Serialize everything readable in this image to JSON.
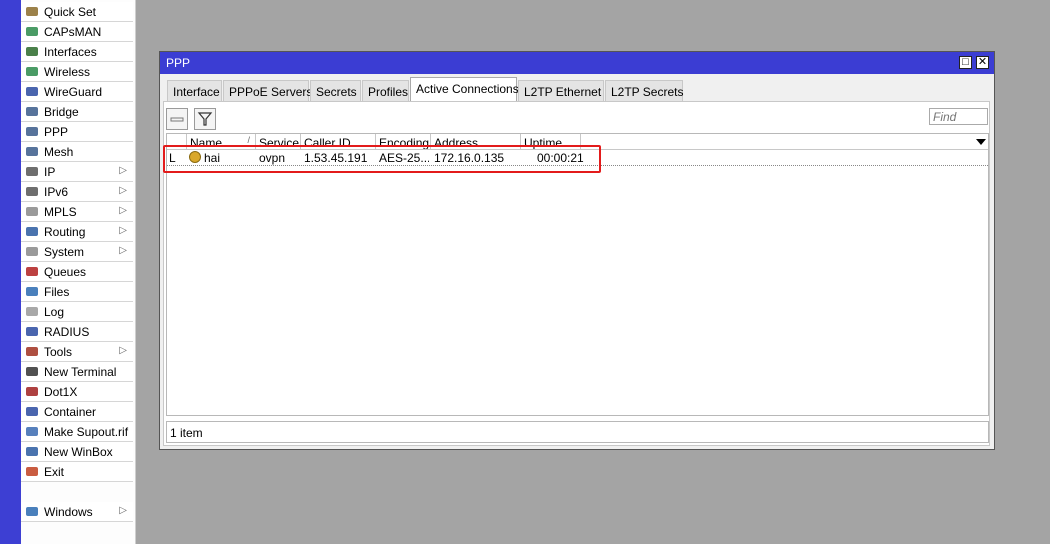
{
  "sidebar": {
    "items": [
      {
        "label": "Quick Set",
        "icon": "wand-icon",
        "submenu": false
      },
      {
        "label": "CAPsMAN",
        "icon": "capsman-icon",
        "submenu": false
      },
      {
        "label": "Interfaces",
        "icon": "interfaces-icon",
        "submenu": false
      },
      {
        "label": "Wireless",
        "icon": "wireless-icon",
        "submenu": false
      },
      {
        "label": "WireGuard",
        "icon": "wireguard-icon",
        "submenu": false
      },
      {
        "label": "Bridge",
        "icon": "bridge-icon",
        "submenu": false
      },
      {
        "label": "PPP",
        "icon": "ppp-icon",
        "submenu": false
      },
      {
        "label": "Mesh",
        "icon": "mesh-icon",
        "submenu": false
      },
      {
        "label": "IP",
        "icon": "ip-icon",
        "submenu": true
      },
      {
        "label": "IPv6",
        "icon": "ipv6-icon",
        "submenu": true
      },
      {
        "label": "MPLS",
        "icon": "mpls-icon",
        "submenu": true
      },
      {
        "label": "Routing",
        "icon": "routing-icon",
        "submenu": true
      },
      {
        "label": "System",
        "icon": "gear-icon",
        "submenu": true
      },
      {
        "label": "Queues",
        "icon": "queues-icon",
        "submenu": false
      },
      {
        "label": "Files",
        "icon": "folder-icon",
        "submenu": false
      },
      {
        "label": "Log",
        "icon": "log-icon",
        "submenu": false
      },
      {
        "label": "RADIUS",
        "icon": "radius-icon",
        "submenu": false
      },
      {
        "label": "Tools",
        "icon": "tools-icon",
        "submenu": true
      },
      {
        "label": "New Terminal",
        "icon": "terminal-icon",
        "submenu": false
      },
      {
        "label": "Dot1X",
        "icon": "dot1x-icon",
        "submenu": false
      },
      {
        "label": "Container",
        "icon": "container-icon",
        "submenu": false
      },
      {
        "label": "Make Supout.rif",
        "icon": "supout-icon",
        "submenu": false
      },
      {
        "label": "New WinBox",
        "icon": "winbox-icon",
        "submenu": false
      },
      {
        "label": "Exit",
        "icon": "exit-icon",
        "submenu": false
      }
    ],
    "windows_item": {
      "label": "Windows",
      "icon": "windows-icon",
      "submenu": true
    },
    "submenu_arrow": "▷"
  },
  "window": {
    "title": "PPP",
    "restore_glyph": "□",
    "close_glyph": "✕",
    "tabs": [
      {
        "label": "Interface",
        "active": false
      },
      {
        "label": "PPPoE Servers",
        "active": false
      },
      {
        "label": "Secrets",
        "active": false
      },
      {
        "label": "Profiles",
        "active": false
      },
      {
        "label": "Active Connections",
        "active": true
      },
      {
        "label": "L2TP Ethernet",
        "active": false
      },
      {
        "label": "L2TP Secrets",
        "active": false
      }
    ],
    "find_placeholder": "Find",
    "columns": [
      "Name",
      "Service",
      "Caller ID",
      "Encoding",
      "Address",
      "Uptime"
    ],
    "sort_indicator": "/",
    "rows": [
      {
        "flag": "L",
        "name": "hai",
        "service": "ovpn",
        "caller_id": "1.53.45.191",
        "encoding": "AES-25...",
        "address": "172.16.0.135",
        "uptime": "00:00:21"
      }
    ],
    "status": "1 item"
  },
  "colors": {
    "accent": "#3b3dd3",
    "highlight": "#e31b1b",
    "background": "#a4a4a4"
  }
}
